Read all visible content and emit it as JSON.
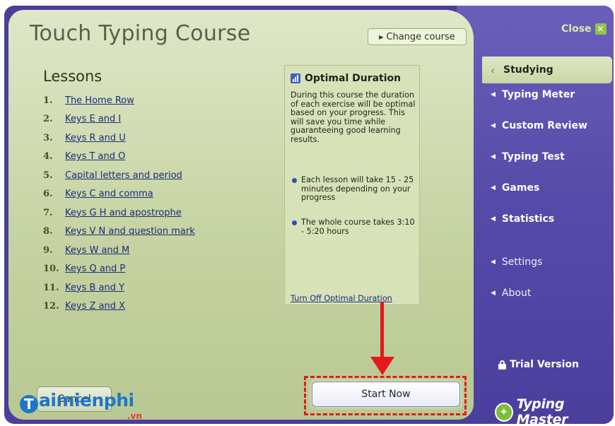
{
  "app": {
    "title": "Touch Typing Course",
    "change_course_label": "Change course",
    "close_label": "Close"
  },
  "lessons": {
    "heading": "Lessons",
    "items": [
      {
        "num": "1.",
        "label": "The Home Row"
      },
      {
        "num": "2.",
        "label": "Keys E and I"
      },
      {
        "num": "3.",
        "label": "Keys R and U"
      },
      {
        "num": "4.",
        "label": "Keys T and O"
      },
      {
        "num": "5.",
        "label": "Capital letters and period"
      },
      {
        "num": "6.",
        "label": "Keys C and comma"
      },
      {
        "num": "7.",
        "label": "Keys G H and apostrophe"
      },
      {
        "num": "8.",
        "label": "Keys V N and question mark"
      },
      {
        "num": "9.",
        "label": "Keys W and M"
      },
      {
        "num": "10.",
        "label": "Keys Q and P"
      },
      {
        "num": "11.",
        "label": "Keys B and Y"
      },
      {
        "num": "12.",
        "label": "Keys Z and X"
      }
    ]
  },
  "info": {
    "title": "Optimal Duration",
    "description": "During this course the duration of each exercise will be optimal based on your progress. This will save you time while guaranteeing good learning results.",
    "bullets": [
      "Each lesson will take 15 - 25 minutes depending on your progress",
      "The whole course takes 3:10 - 5:20 hours"
    ],
    "turn_off_label": "Turn Off Optimal Duration"
  },
  "buttons": {
    "cancel": "Cancel",
    "start": "Start Now"
  },
  "nav": {
    "active": "Studying",
    "items": [
      "Typing Meter",
      "Custom Review",
      "Typing Test",
      "Games",
      "Statistics"
    ],
    "secondary": [
      "Settings",
      "About"
    ]
  },
  "trial_label": "Trial Version",
  "brand": {
    "name": "Typing Master"
  },
  "watermark": {
    "initial": "T",
    "rest": "aimienphi",
    "suffix": ".vn"
  },
  "colors": {
    "sidebar": "#574ba9",
    "main_panel": "#c6d3a2",
    "link": "#1d2c7a",
    "highlight": "#e3191a"
  }
}
